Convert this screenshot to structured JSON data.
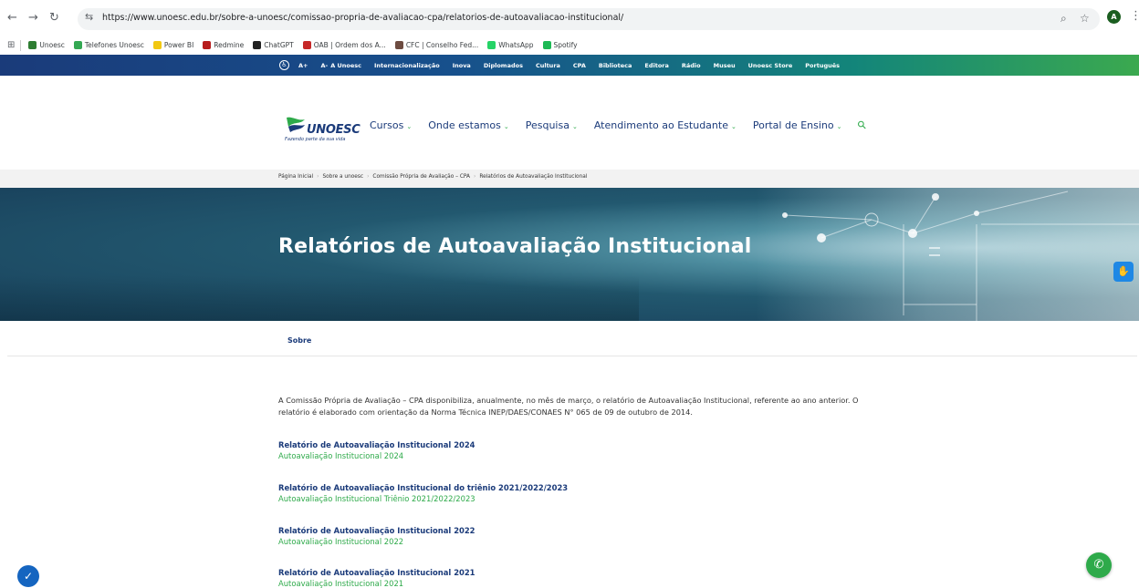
{
  "browser": {
    "url": "https://www.unoesc.edu.br/sobre-a-unoesc/comissao-propria-de-avaliacao-cpa/relatorios-de-autoavaliacao-institucional/",
    "profile_initial": "A",
    "bookmarks": [
      {
        "label": "Unoesc",
        "color": "#2e7d32"
      },
      {
        "label": "Telefones Unoesc",
        "color": "#34a853"
      },
      {
        "label": "Power BI",
        "color": "#f2c811"
      },
      {
        "label": "Redmine",
        "color": "#b71c1c"
      },
      {
        "label": "ChatGPT",
        "color": "#222222"
      },
      {
        "label": "OAB | Ordem dos A...",
        "color": "#c62828"
      },
      {
        "label": "CFC | Conselho Fed...",
        "color": "#6d4c41"
      },
      {
        "label": "WhatsApp",
        "color": "#25d366"
      },
      {
        "label": "Spotify",
        "color": "#1db954"
      }
    ]
  },
  "topbar": {
    "font_plus": "A+",
    "font_minus": "A-",
    "links": [
      "A Unoesc",
      "Internacionalização",
      "Inova",
      "Diplomados",
      "Cultura",
      "CPA",
      "Biblioteca",
      "Editora",
      "Rádio",
      "Museu",
      "Unoesc Store",
      "Português"
    ]
  },
  "header": {
    "logo_text": "UNOESC",
    "logo_tagline": "Fazendo parte da sua vida",
    "nav": [
      "Cursos",
      "Onde estamos",
      "Pesquisa",
      "Atendimento ao Estudante",
      "Portal de Ensino"
    ]
  },
  "breadcrumb": [
    "Página Inicial",
    "Sobre a unoesc",
    "Comissão Própria de Avaliação – CPA",
    "Relatórios de Autoavaliação Institucional"
  ],
  "hero": {
    "title": "Relatórios de Autoavaliação Institucional"
  },
  "subnav": {
    "tab": "Sobre"
  },
  "content": {
    "intro": "A Comissão Própria de Avaliação – CPA disponibiliza, anualmente, no mês de março, o relatório de Autoavaliação Institucional, referente ao ano anterior. O relatório é elaborado com orientação da Norma Técnica INEP/DAES/CONAES N° 065 de 09 de outubro de 2014.",
    "reports": [
      {
        "title": "Relatório de Autoavaliação Institucional 2024",
        "link": "Autoavaliação Institucional 2024"
      },
      {
        "title": "Relatório de Autoavaliação Institucional do triênio 2021/2022/2023",
        "link": "Autoavaliação Institucional Triênio 2021/2022/2023"
      },
      {
        "title": "Relatório de Autoavaliação Institucional 2022",
        "link": "Autoavaliação Institucional 2022"
      },
      {
        "title": "Relatório de Autoavaliação Institucional 2021",
        "link": "Autoavaliação Institucional 2021"
      }
    ]
  }
}
